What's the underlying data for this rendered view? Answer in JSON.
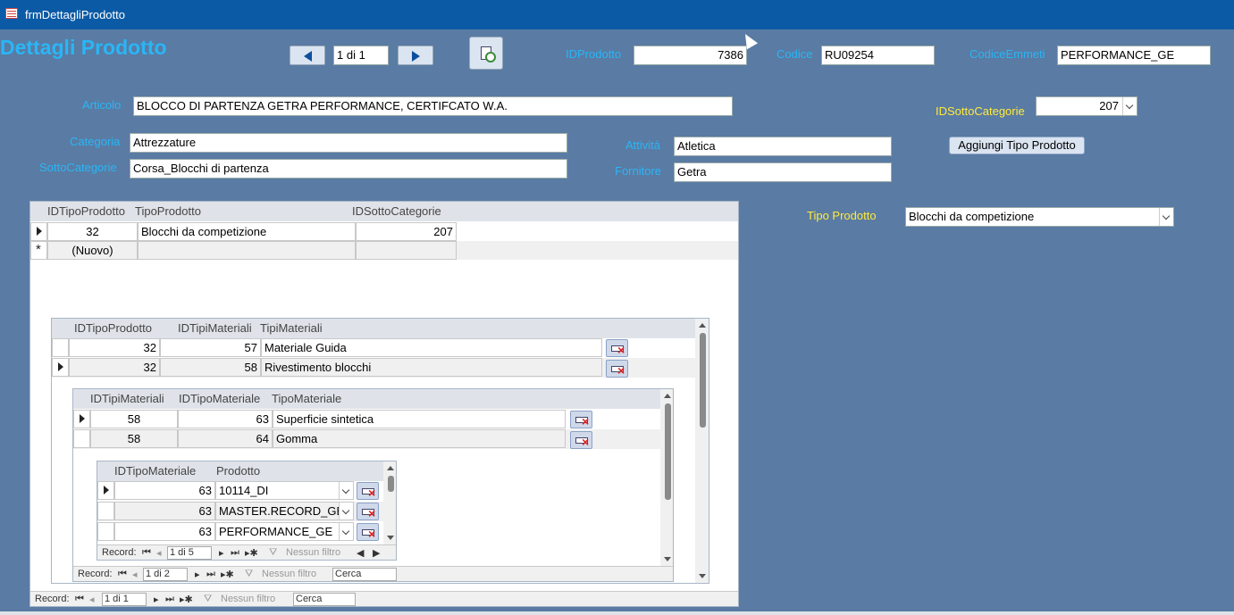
{
  "window": {
    "title": "frmDettagliProdotto"
  },
  "form": {
    "heading": "Dettagli Prodotto",
    "record_nav": {
      "position": "1 di 1"
    },
    "fields": {
      "idprodotto": {
        "label": "IDProdotto",
        "value": "7386"
      },
      "codice": {
        "label": "Codice",
        "value": "RU09254"
      },
      "codice_emmeti": {
        "label": "CodiceEmmeti",
        "value": "PERFORMANCE_GE"
      },
      "articolo": {
        "label": "Articolo",
        "value": "BLOCCO DI PARTENZA GETRA PERFORMANCE, CERTIFCATO W.A."
      },
      "idsottocategorie": {
        "label": "IDSottoCategorie",
        "value": "207"
      },
      "categoria": {
        "label": "Categoria",
        "value": "Attrezzature"
      },
      "sottocategorie": {
        "label": "SottoCategorie",
        "value": "Corsa_Blocchi di partenza"
      },
      "attivita": {
        "label": "Attività",
        "value": "Atletica"
      },
      "fornitore": {
        "label": "Fornitore",
        "value": "Getra"
      },
      "tipo_prodotto": {
        "label": "Tipo Prodotto",
        "value": "Blocchi da competizione"
      }
    },
    "add_button": "Aggiungi Tipo Prodotto"
  },
  "sub1": {
    "headers": [
      "IDTipoProdotto",
      "TipoProdotto",
      "IDSottoCategorie"
    ],
    "rows": [
      {
        "id": "32",
        "tipo": "Blocchi da competizione",
        "idsc": "207"
      }
    ],
    "new_row_label": "(Nuovo)",
    "nav": {
      "record_label": "Record:",
      "position": "1 di 1",
      "filter": "Nessun filtro",
      "search": "Cerca"
    }
  },
  "sub2": {
    "headers": [
      "IDTipoProdotto",
      "IDTipiMateriali",
      "TipiMateriali"
    ],
    "rows": [
      {
        "a": "32",
        "b": "57",
        "c": "Materiale Guida"
      },
      {
        "a": "32",
        "b": "58",
        "c": "Rivestimento blocchi"
      }
    ]
  },
  "sub3": {
    "headers": [
      "IDTipiMateriali",
      "IDTipoMateriale",
      "TipoMateriale"
    ],
    "rows": [
      {
        "a": "58",
        "b": "63",
        "c": "Superficie sintetica"
      },
      {
        "a": "58",
        "b": "64",
        "c": "Gomma"
      }
    ],
    "nav": {
      "record_label": "Record:",
      "position": "1 di 2",
      "filter": "Nessun filtro",
      "search": "Cerca"
    }
  },
  "sub4": {
    "headers": [
      "IDTipoMateriale",
      "Prodotto"
    ],
    "rows": [
      {
        "a": "63",
        "b": "10114_DI"
      },
      {
        "a": "63",
        "b": "MASTER.RECORD_GE"
      },
      {
        "a": "63",
        "b": "PERFORMANCE_GE"
      }
    ],
    "nav": {
      "record_label": "Record:",
      "position": "1 di 5",
      "filter": "Nessun filtro"
    }
  }
}
